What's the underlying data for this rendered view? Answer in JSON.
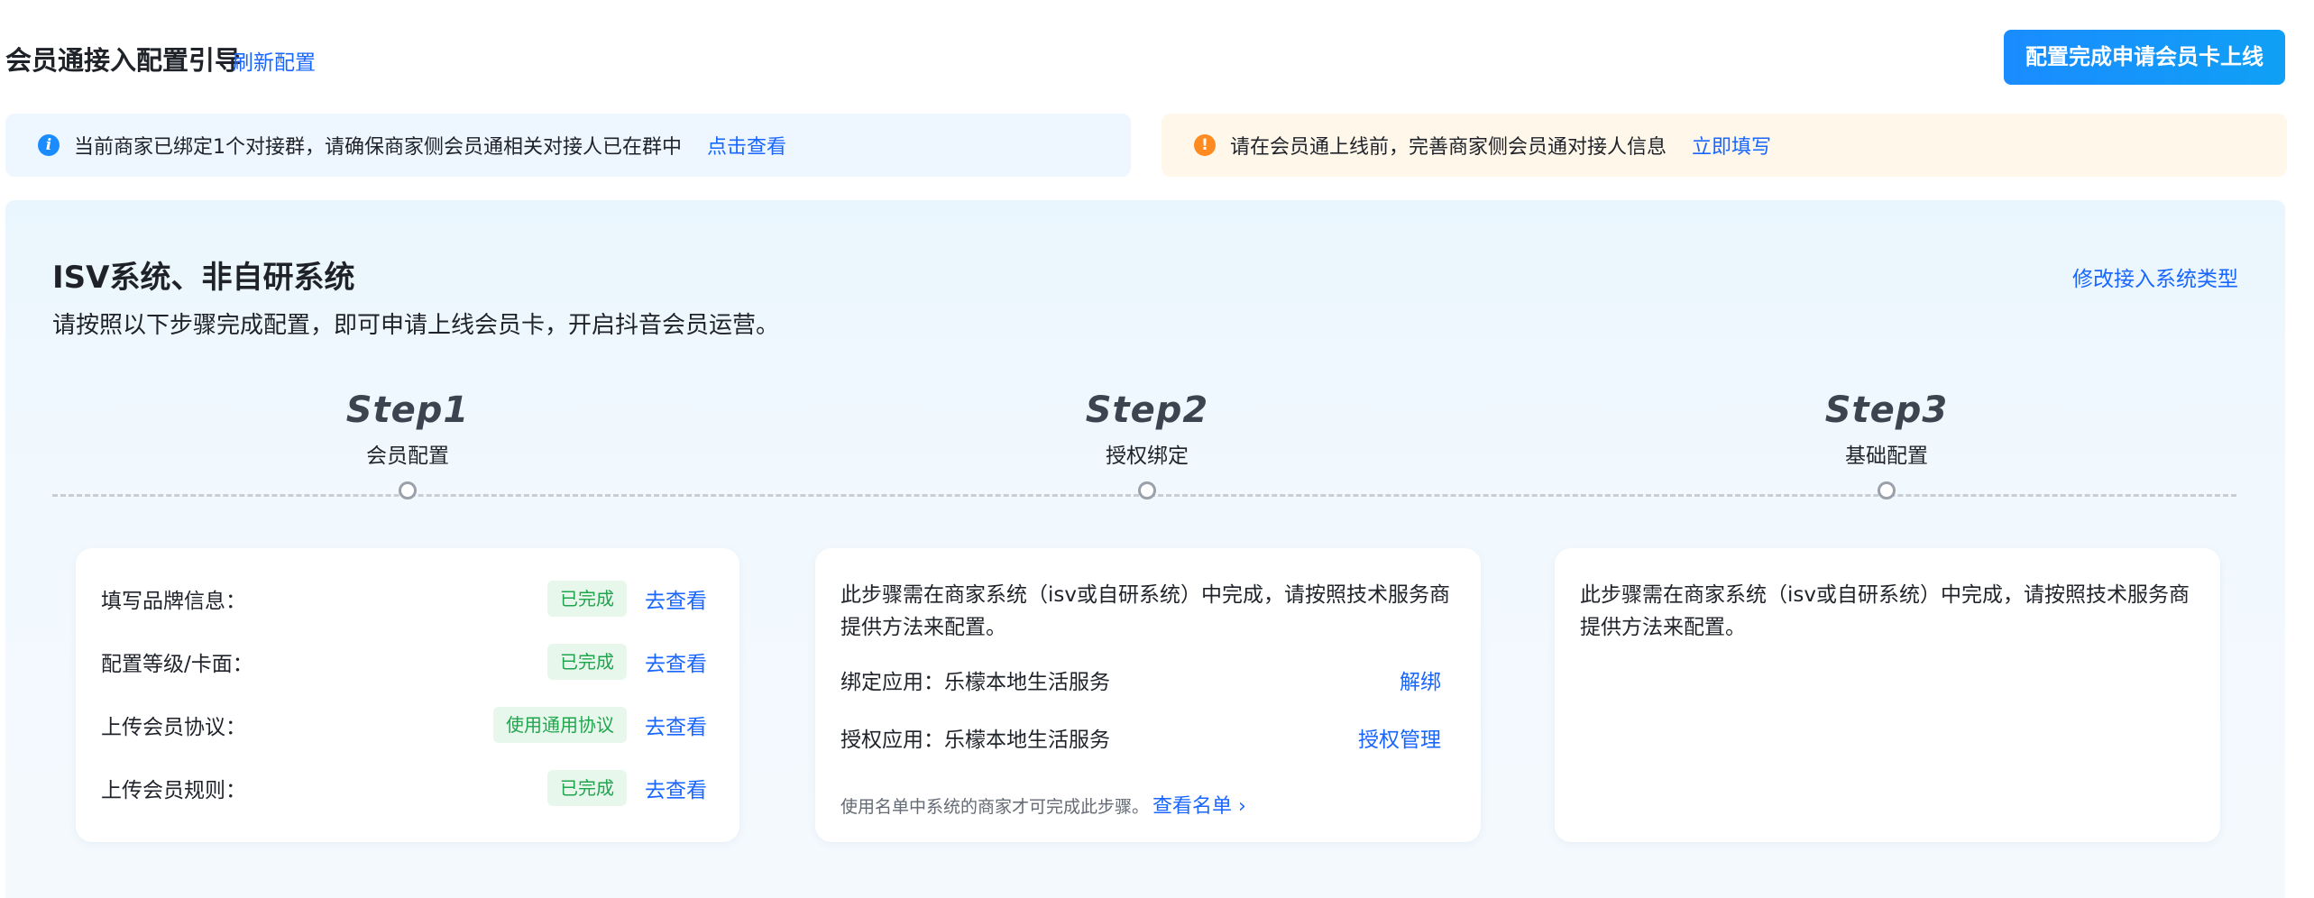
{
  "header": {
    "title": "会员通接入配置引导",
    "refresh_label": "刷新配置",
    "submit_label": "配置完成申请会员卡上线"
  },
  "alerts": {
    "info": {
      "icon": "info-icon",
      "message": "当前商家已绑定1个对接群，请确保商家侧会员通相关对接人已在群中",
      "action": "点击查看"
    },
    "warning": {
      "icon": "warning-icon",
      "message": "请在会员通上线前，完善商家侧会员通对接人信息",
      "action": "立即填写"
    }
  },
  "panel": {
    "title": "ISV系统、非自研系统",
    "subtitle": "请按照以下步骤完成配置，即可申请上线会员卡，开启抖音会员运营。",
    "change_type_label": "修改接入系统类型"
  },
  "steps": [
    {
      "number": "Step1",
      "name": "会员配置"
    },
    {
      "number": "Step2",
      "name": "授权绑定"
    },
    {
      "number": "Step3",
      "name": "基础配置"
    }
  ],
  "step1": {
    "rows": [
      {
        "label": "填写品牌信息：",
        "status": "已完成",
        "action": "去查看"
      },
      {
        "label": "配置等级/卡面：",
        "status": "已完成",
        "action": "去查看"
      },
      {
        "label": "上传会员协议：",
        "status": "使用通用协议",
        "action": "去查看"
      },
      {
        "label": "上传会员规则：",
        "status": "已完成",
        "action": "去查看"
      }
    ]
  },
  "step2": {
    "description": "此步骤需在商家系统（isv或自研系统）中完成，请按照技术服务商提供方法来配置。",
    "bind_app_label": "绑定应用：乐檬本地生活服务",
    "bind_action": "解绑",
    "auth_app_label": "授权应用：乐檬本地生活服务",
    "auth_action": "授权管理",
    "note": "使用名单中系统的商家才可完成此步骤。",
    "list_link": "查看名单 ›"
  },
  "step3": {
    "description": "此步骤需在商家系统（isv或自研系统）中完成，请按照技术服务商提供方法来配置。"
  },
  "colors": {
    "accent": "#1966ff",
    "primary_button": "#1890ff",
    "success_text": "#1fa54d",
    "success_bg": "#e8f7ec",
    "info_bg": "#eef7ff",
    "warning_bg": "#fff7ea",
    "warning_icon": "#ff8a1f"
  }
}
